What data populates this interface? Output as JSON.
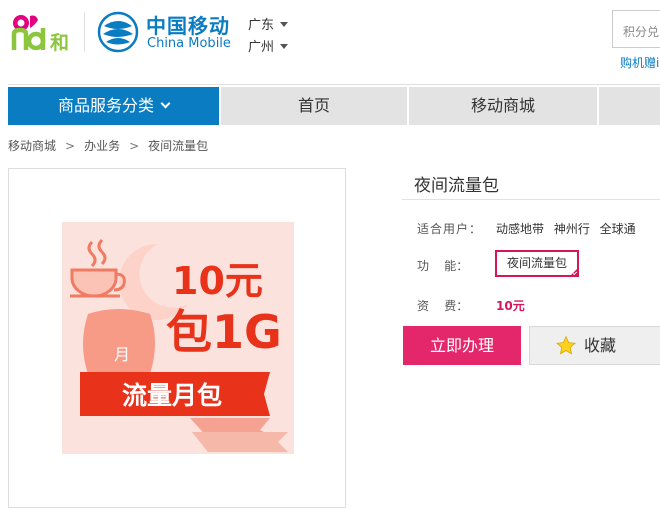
{
  "header": {
    "brand_and_char": "和",
    "logo_cn": "中国移动",
    "logo_en": "China Mobile",
    "province": "广东",
    "city": "广州",
    "points_placeholder": "积分兑",
    "points_link": "购机赠i"
  },
  "nav": {
    "category": "商品服务分类",
    "home": "首页",
    "mall": "移动商城"
  },
  "breadcrumb": [
    "移动商城",
    "办业务",
    "夜间流量包"
  ],
  "product": {
    "title": "夜间流量包",
    "users_label": "适合用户：",
    "users_value": "动感地带 神州行 全球通",
    "func_label": "功    能：",
    "func_value": "夜间流量包",
    "fee_label": "资    费：",
    "fee_value": "10元",
    "handle_button": "立即办理",
    "fav_button": "收藏"
  },
  "promo_image": {
    "price": "10元",
    "volume": "包1G",
    "moon_char": "月",
    "ribbon": "流量月包"
  },
  "colors": {
    "brand_blue": "#0a7cc1",
    "accent_pink": "#e3276a",
    "promo_red": "#e8321a"
  },
  "icons": {
    "location_dropdown": "caret-down-icon",
    "category_dropdown": "chevron-down-icon",
    "favorite": "star-icon",
    "selected": "check-corner-icon"
  }
}
